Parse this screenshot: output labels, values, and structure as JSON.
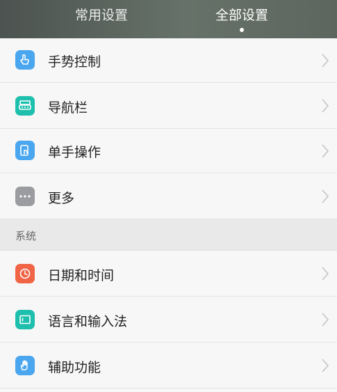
{
  "header": {
    "tabs": [
      {
        "label": "常用设置",
        "active": false
      },
      {
        "label": "全部设置",
        "active": true
      }
    ]
  },
  "group_top": {
    "items": [
      {
        "label": "手势控制",
        "icon": "gesture-hand-icon",
        "color": "#4aa6ef"
      },
      {
        "label": "导航栏",
        "icon": "navigation-bar-icon",
        "color": "#1fbfae"
      },
      {
        "label": "单手操作",
        "icon": "one-hand-icon",
        "color": "#4aa6ef"
      },
      {
        "label": "更多",
        "icon": "more-dots-icon",
        "color": "#9a9ca0"
      }
    ]
  },
  "section_system": {
    "title": "系统",
    "items": [
      {
        "label": "日期和时间",
        "icon": "clock-icon",
        "color": "#f06545"
      },
      {
        "label": "语言和输入法",
        "icon": "keyboard-icon",
        "color": "#1fbfae"
      },
      {
        "label": "辅助功能",
        "icon": "accessibility-hand-icon",
        "color": "#4aa6ef"
      }
    ]
  }
}
